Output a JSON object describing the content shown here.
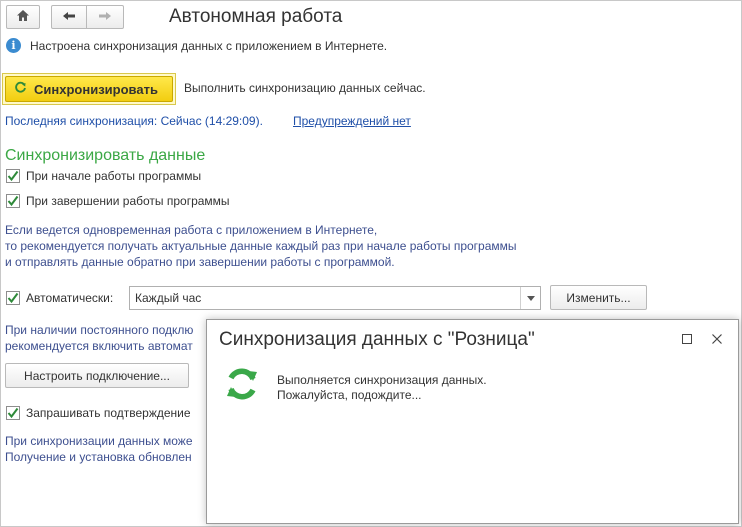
{
  "window": {
    "title": "Автономная работа"
  },
  "info": {
    "text": "Настроена синхронизация данных с приложением в Интернете."
  },
  "sync": {
    "button_label": "Синхронизировать",
    "description": "Выполнить синхронизацию данных сейчас.",
    "last_sync": "Последняя синхронизация: Сейчас (14:29:09).",
    "warnings_link": "Предупреждений нет"
  },
  "section": {
    "title": "Синхронизировать данные",
    "on_start_label": "При начале работы программы",
    "on_exit_label": "При завершении работы программы",
    "note_lines": [
      "Если ведется одновременная работа с приложением в Интернете,",
      "то рекомендуется получать актуальные данные каждый раз при начале работы программы",
      "и отправлять данные обратно при завершении работы с программой."
    ]
  },
  "auto": {
    "label": "Автоматически:",
    "selected": "Каждый час",
    "change_button": "Изменить..."
  },
  "connection": {
    "note_lines": [
      "При наличии постоянного подклю",
      "рекомендуется включить автомат"
    ],
    "setup_button": "Настроить подключение..."
  },
  "confirm": {
    "label": "Запрашивать подтверждение"
  },
  "update": {
    "note_lines": [
      "При синхронизации данных може",
      "Получение и установка обновлен"
    ]
  },
  "dialog": {
    "title": "Синхронизация данных с \"Розница\"",
    "message_line1": "Выполняется синхронизация данных.",
    "message_line2": "Пожалуйста, подождите..."
  },
  "colors": {
    "accent_yellow": "#f2cd10",
    "section_green": "#3ba845",
    "link_blue": "#1f4fa8",
    "note_blue": "#3d4f8f",
    "check_green": "#2f8a3a"
  }
}
